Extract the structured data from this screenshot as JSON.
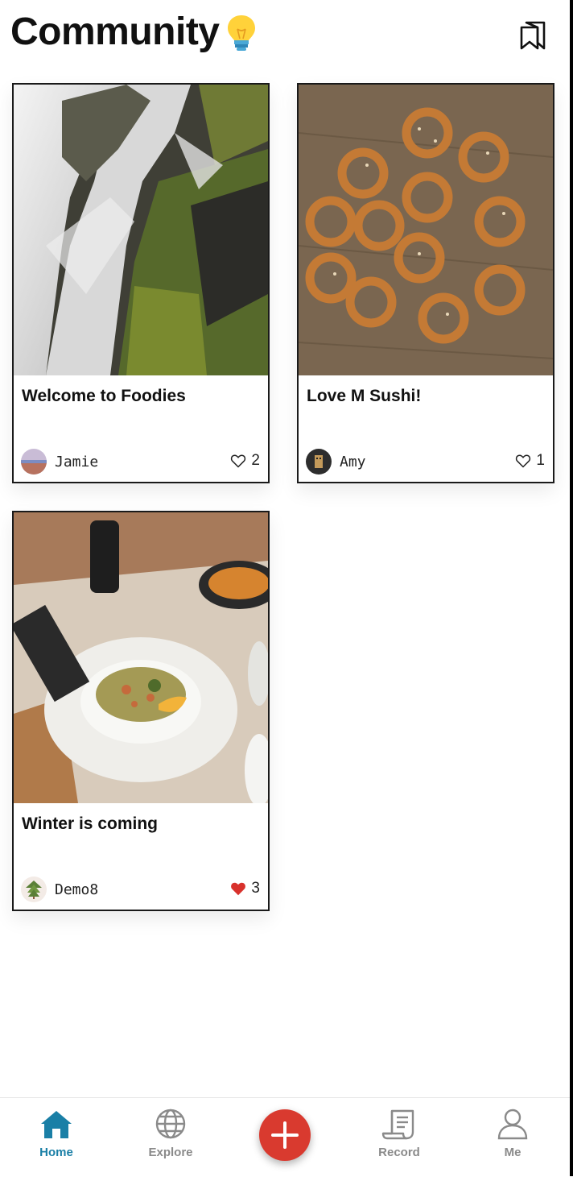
{
  "header": {
    "title": "Community",
    "bulb_icon": "lightbulb-icon",
    "bookmark_icon": "bookmarks-icon"
  },
  "posts": [
    {
      "title": "Welcome to Foodies",
      "author": "Jamie",
      "likes": "2",
      "liked": false
    },
    {
      "title": "Love M Sushi!",
      "author": "Amy",
      "likes": "1",
      "liked": false
    },
    {
      "title": "Winter is coming",
      "author": "Demo8",
      "likes": "3",
      "liked": true
    }
  ],
  "nav": {
    "home": "Home",
    "explore": "Explore",
    "record": "Record",
    "me": "Me",
    "active_color": "#1a7fa6",
    "inactive_color": "#8a8a8a",
    "fab_color": "#d93a2f"
  }
}
